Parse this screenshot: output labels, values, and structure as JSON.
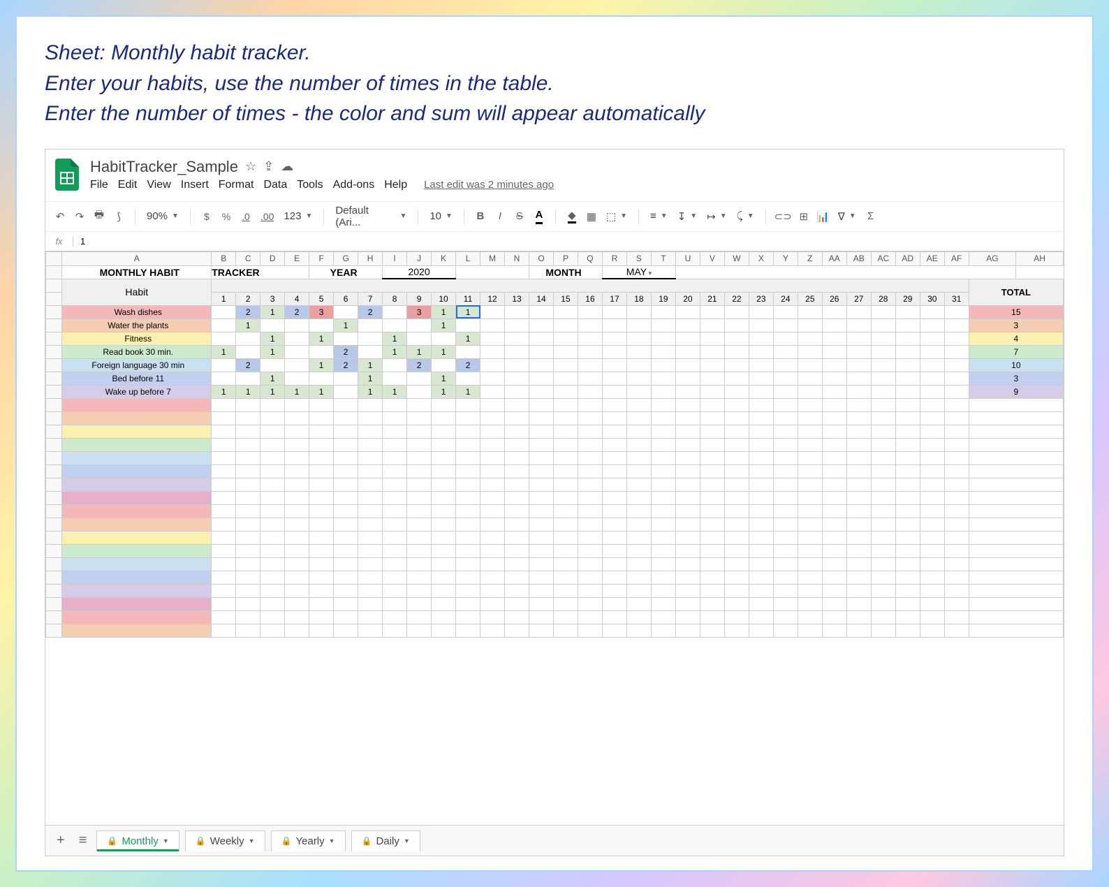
{
  "description": {
    "line1": "Sheet: Monthly habit tracker.",
    "line2": "Enter your habits, use the number of times in the table.",
    "line3": "Enter the number of times - the color and sum will appear automatically"
  },
  "doc": {
    "title": "HabitTracker_Sample",
    "last_edit": "Last edit was 2 minutes ago"
  },
  "menu": {
    "file": "File",
    "edit": "Edit",
    "view": "View",
    "insert": "Insert",
    "format": "Format",
    "data": "Data",
    "tools": "Tools",
    "addons": "Add-ons",
    "help": "Help"
  },
  "toolbar": {
    "zoom": "90%",
    "currency": "$",
    "percent": "%",
    "dec_dec": ".0",
    "dec_inc": ".00",
    "fmt123": "123",
    "font": "Default (Ari...",
    "font_size": "10",
    "bold": "B",
    "italic": "I",
    "strike": "S",
    "textcolor": "A"
  },
  "formula_bar": {
    "fx": "fx",
    "value": "1"
  },
  "columns": [
    "A",
    "B",
    "C",
    "D",
    "E",
    "F",
    "G",
    "H",
    "I",
    "J",
    "K",
    "L",
    "M",
    "N",
    "O",
    "P",
    "Q",
    "R",
    "S",
    "T",
    "U",
    "V",
    "W",
    "X",
    "Y",
    "Z",
    "AA",
    "AB",
    "AC",
    "AD",
    "AE",
    "AF",
    "AG",
    "AH"
  ],
  "header": {
    "title": "MONTHLY HABIT",
    "tracker": "TRACKER",
    "year_label": "YEAR",
    "year_value": "2020",
    "month_label": "MONTH",
    "month_value": "MAY"
  },
  "table": {
    "habit_header": "Habit",
    "total_header": "TOTAL",
    "days": [
      "1",
      "2",
      "3",
      "4",
      "5",
      "6",
      "7",
      "8",
      "9",
      "10",
      "11",
      "12",
      "13",
      "14",
      "15",
      "16",
      "17",
      "18",
      "19",
      "20",
      "21",
      "22",
      "23",
      "24",
      "25",
      "26",
      "27",
      "28",
      "29",
      "30",
      "31"
    ]
  },
  "habits": [
    {
      "name": "Wash dishes",
      "color": "#f5b7b7",
      "vals": {
        "2": "2",
        "3": "1",
        "4": "2",
        "5": "3",
        "7": "2",
        "9": "3",
        "10": "1",
        "11": "1"
      },
      "total": "15",
      "tcolor": "#f5b7b7"
    },
    {
      "name": "Water the plants",
      "color": "#f5cdb0",
      "vals": {
        "2": "1",
        "6": "1",
        "10": "1"
      },
      "total": "3",
      "tcolor": "#f5cdb0"
    },
    {
      "name": "Fitness",
      "color": "#faf0b0",
      "vals": {
        "3": "1",
        "5": "1",
        "8": "1",
        "11": "1"
      },
      "total": "4",
      "tcolor": "#faf0b0"
    },
    {
      "name": "Read book 30 min.",
      "color": "#cceacc",
      "vals": {
        "1": "1",
        "3": "1",
        "6": "2",
        "8": "1",
        "9": "1",
        "10": "1"
      },
      "total": "7",
      "tcolor": "#cceacc"
    },
    {
      "name": "Foreign language 30 min",
      "color": "#c8e0f0",
      "vals": {
        "2": "2",
        "5": "1",
        "6": "2",
        "7": "1",
        "9": "2",
        "11": "2"
      },
      "total": "10",
      "tcolor": "#c8e0f0"
    },
    {
      "name": "Bed before 11",
      "color": "#c0d0ee",
      "vals": {
        "3": "1",
        "7": "1",
        "10": "1"
      },
      "total": "3",
      "tcolor": "#c0d0ee"
    },
    {
      "name": "Wake up before 7",
      "color": "#d5cce8",
      "vals": {
        "1": "1",
        "2": "1",
        "3": "1",
        "4": "1",
        "5": "1",
        "7": "1",
        "8": "1",
        "10": "1",
        "11": "1"
      },
      "total": "9",
      "tcolor": "#d5cce8"
    }
  ],
  "empty_row_colors": [
    "#f5b7b7",
    "#f5cdb0",
    "#faf0b0",
    "#cceacc",
    "#c8e0f0",
    "#c0d0ee",
    "#d5cce8",
    "#e8b0c8",
    "#f5b7b7",
    "#f5cdb0",
    "#faf0b0",
    "#cceacc",
    "#c8e0f0",
    "#c0d0ee",
    "#d5cce8",
    "#e8b0c8",
    "#f5b7b7",
    "#f5cdb0"
  ],
  "sheets": {
    "monthly": "Monthly",
    "weekly": "Weekly",
    "yearly": "Yearly",
    "daily": "Daily"
  },
  "selected_cell": {
    "row": 0,
    "day": "11"
  }
}
